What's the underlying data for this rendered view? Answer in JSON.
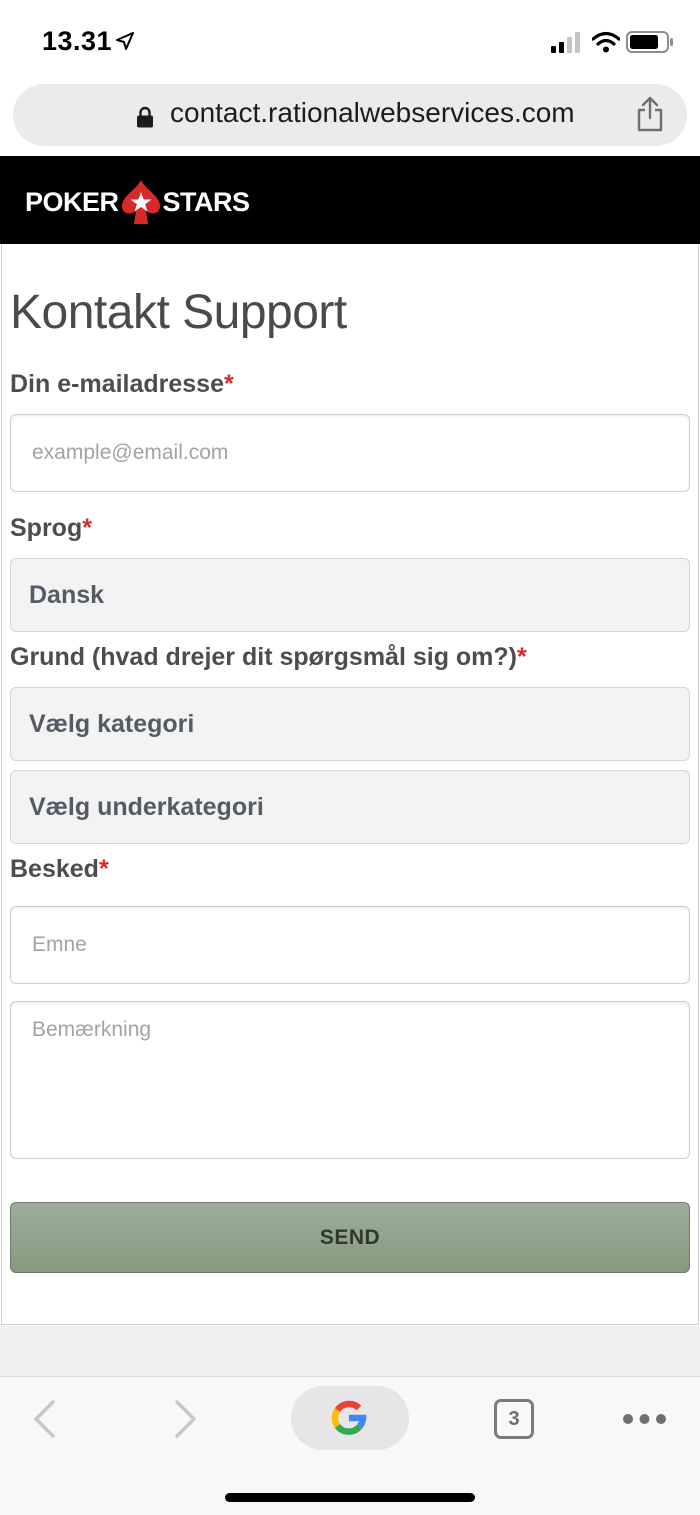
{
  "status_bar": {
    "time": "13.31",
    "icons": [
      "location-arrow-icon",
      "cellular-signal-icon",
      "wifi-icon",
      "battery-icon"
    ]
  },
  "browser": {
    "url": "contact.rationalwebservices.com",
    "icons": [
      "lock-icon",
      "share-icon"
    ]
  },
  "brand": {
    "logo_left": "POKER",
    "logo_right": "STARS",
    "logo_color": "#d62a2a"
  },
  "form": {
    "title": "Kontakt Support",
    "required_mark": "*",
    "email_label": "Din e-mailadresse",
    "email_placeholder": "example@email.com",
    "language_label": "Sprog",
    "language_value": "Dansk",
    "reason_label": "Grund (hvad drejer dit spørgsmål sig om?)",
    "category_value": "Vælg kategori",
    "subcategory_value": "Vælg underkategori",
    "message_label": "Besked",
    "subject_placeholder": "Emne",
    "remark_placeholder": "Bemærkning",
    "send_label": "SEND",
    "send_color": "#93a58e"
  },
  "toolbar": {
    "tab_count": "3",
    "icons": [
      "back-icon",
      "forward-icon",
      "google-icon",
      "more-icon"
    ]
  }
}
